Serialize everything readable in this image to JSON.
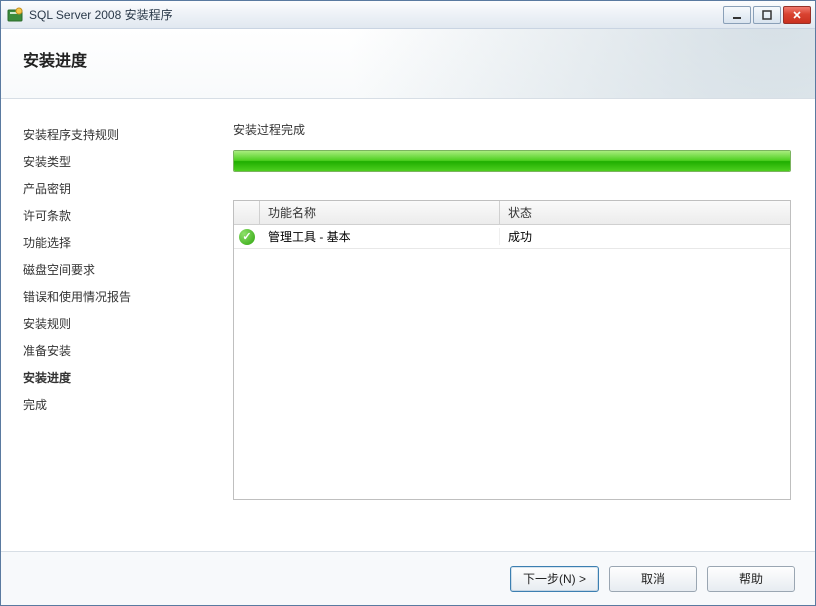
{
  "window": {
    "title": "SQL Server 2008 安装程序"
  },
  "header": {
    "heading": "安装进度"
  },
  "sidebar": {
    "items": [
      {
        "label": "安装程序支持规则",
        "current": false
      },
      {
        "label": "安装类型",
        "current": false
      },
      {
        "label": "产品密钥",
        "current": false
      },
      {
        "label": "许可条款",
        "current": false
      },
      {
        "label": "功能选择",
        "current": false
      },
      {
        "label": "磁盘空间要求",
        "current": false
      },
      {
        "label": "错误和使用情况报告",
        "current": false
      },
      {
        "label": "安装规则",
        "current": false
      },
      {
        "label": "准备安装",
        "current": false
      },
      {
        "label": "安装进度",
        "current": true
      },
      {
        "label": "完成",
        "current": false
      }
    ]
  },
  "content": {
    "status_text": "安装过程完成",
    "progress_percent": 100,
    "table": {
      "columns": {
        "name": "功能名称",
        "status": "状态"
      },
      "rows": [
        {
          "name": "管理工具 - 基本",
          "status": "成功",
          "ok": true
        }
      ]
    }
  },
  "footer": {
    "next": "下一步(N) >",
    "cancel": "取消",
    "help": "帮助"
  }
}
